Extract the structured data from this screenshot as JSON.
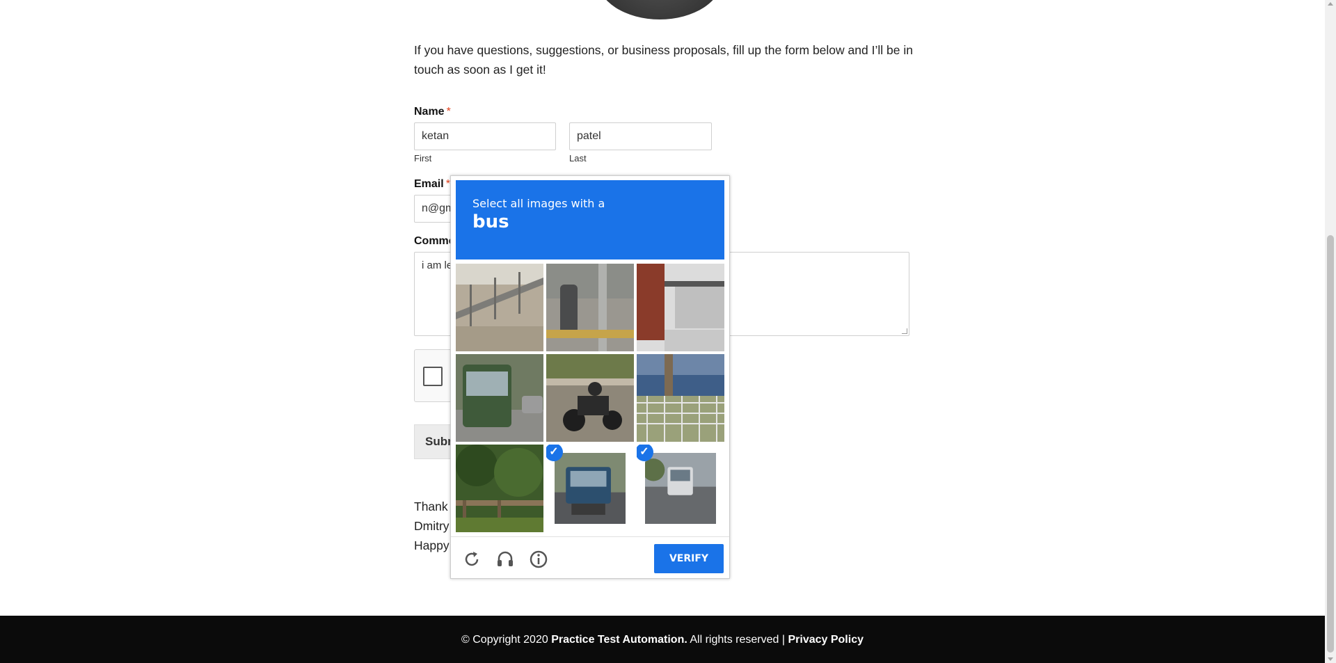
{
  "intro": {
    "text": "If you have questions, suggestions, or business proposals, fill up the form below and I’ll be in touch as soon as I get it!"
  },
  "form": {
    "name_label": "Name",
    "required_mark": "*",
    "first_value": "ketan",
    "first_sublabel": "First",
    "last_value": "patel",
    "last_sublabel": "Last",
    "email_label": "Email",
    "email_value": "n@gm",
    "comment_label": "Comme",
    "comment_value": "i am le",
    "submit_label": "Subm"
  },
  "thanks": {
    "line1": "Thank",
    "line2": "Dmitry",
    "line3": "Happy"
  },
  "captcha": {
    "instruction": "Select all images with a",
    "object": "bus",
    "verify_label": "VERIFY",
    "tiles": [
      {
        "scene": "railing-sidewalk",
        "selected": false
      },
      {
        "scene": "bus-stop-post",
        "selected": false
      },
      {
        "scene": "brick-shelter",
        "selected": false
      },
      {
        "scene": "green-bus",
        "selected": false
      },
      {
        "scene": "motorcycle",
        "selected": false
      },
      {
        "scene": "fence-tree",
        "selected": false
      },
      {
        "scene": "bridge-forest",
        "selected": false
      },
      {
        "scene": "bus-traffic",
        "selected": true
      },
      {
        "scene": "bus-road",
        "selected": true
      }
    ],
    "accent": "#1a73e8"
  },
  "footer": {
    "copyright": "© Copyright 2020",
    "brand": "Practice Test Automation.",
    "rights": "All rights reserved |",
    "privacy": "Privacy Policy"
  }
}
